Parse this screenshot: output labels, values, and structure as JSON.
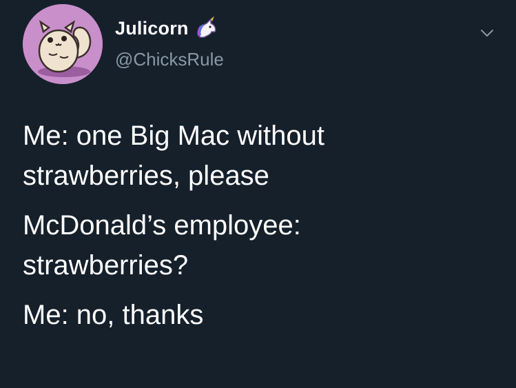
{
  "user": {
    "display_name": "Julicorn",
    "handle": "@ChicksRule",
    "avatar": "squirrel-avatar-icon",
    "badge_emoji": "unicorn-emoji-icon"
  },
  "menu": {
    "icon": "chevron-down-icon"
  },
  "tweet": {
    "lines": [
      [
        "Me: one Big Mac without",
        "strawberries, please"
      ],
      [
        "McDonald’s employee:",
        "strawberries?"
      ],
      [
        "Me: no, thanks"
      ]
    ]
  },
  "colors": {
    "background": "#16202b",
    "text": "#ffffff",
    "handle": "#8899a6",
    "avatar_bg": "#c98fcb"
  }
}
